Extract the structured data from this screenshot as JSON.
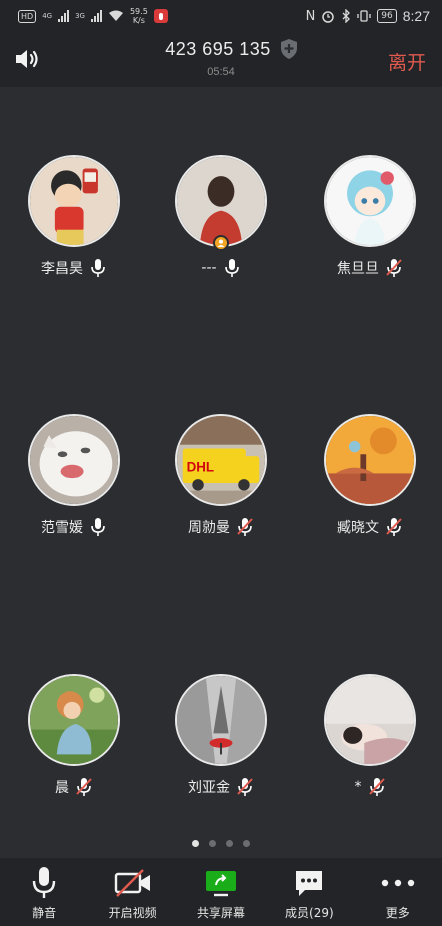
{
  "status_bar": {
    "hd": "HD",
    "net1": "4G",
    "net2": "3G",
    "speed_value": "59.5",
    "speed_unit": "K/s",
    "nfc": "N",
    "battery": "96",
    "time": "8:27"
  },
  "header": {
    "meeting_id": "423 695 135",
    "elapsed": "05:54",
    "leave_label": "离开"
  },
  "participants": [
    {
      "name": "李昌昊",
      "mic": "on",
      "avatar": "cartoon-boy"
    },
    {
      "name": "---",
      "mic": "on",
      "avatar": "girl-back",
      "host": true
    },
    {
      "name": "焦旦旦",
      "mic": "muted",
      "avatar": "anime-girl"
    },
    {
      "name": "范雪媛",
      "mic": "on",
      "avatar": "white-cat"
    },
    {
      "name": "周勍曼",
      "mic": "muted",
      "avatar": "dhl-truck"
    },
    {
      "name": "臧晓文",
      "mic": "muted",
      "avatar": "cartoon-desert"
    },
    {
      "name": "晨",
      "mic": "muted",
      "avatar": "painting-girl"
    },
    {
      "name": "刘亚金",
      "mic": "muted",
      "avatar": "eiffel-umbrella"
    },
    {
      "name": "*",
      "mic": "muted",
      "avatar": "sleeping-person"
    }
  ],
  "pagination": {
    "pages": 4,
    "current": 1
  },
  "toolbar": {
    "mute_label": "静音",
    "video_label": "开启视频",
    "share_label": "共享屏幕",
    "members_label": "成员(29)",
    "more_label": "更多"
  },
  "colors": {
    "background": "#2b2d30",
    "bar": "#232427",
    "leave": "#e05a4f",
    "mic_on": "#ffffff",
    "mic_muted_slash": "#e05a4f",
    "share_green": "#1aad19",
    "host_badge": "#f2a623"
  }
}
